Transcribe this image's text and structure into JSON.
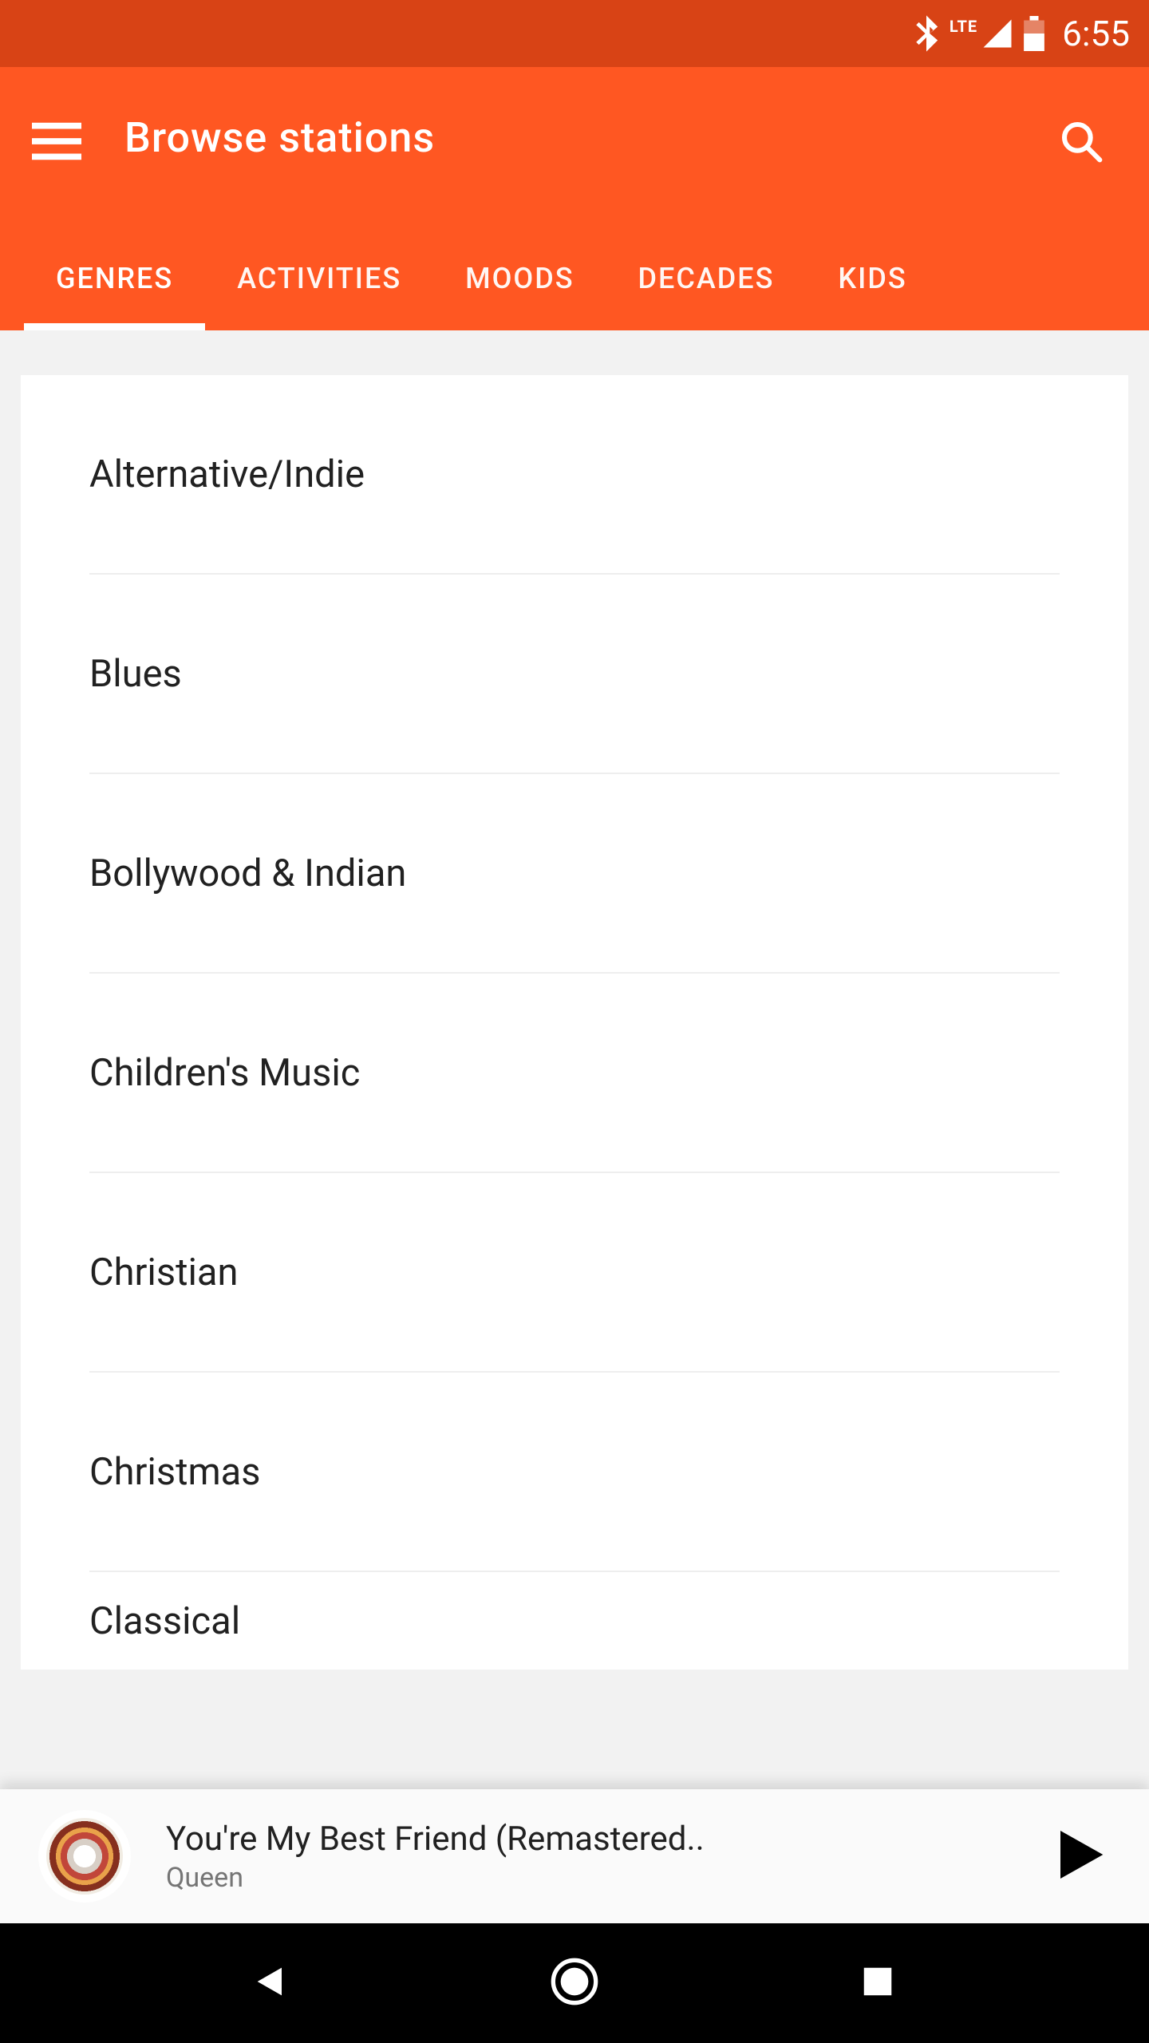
{
  "status_bar": {
    "time": "6:55",
    "network_label": "LTE"
  },
  "header": {
    "title": "Browse stations"
  },
  "tabs": [
    {
      "label": "GENRES",
      "active": true
    },
    {
      "label": "ACTIVITIES",
      "active": false
    },
    {
      "label": "MOODS",
      "active": false
    },
    {
      "label": "DECADES",
      "active": false
    },
    {
      "label": "KIDS",
      "active": false
    }
  ],
  "genres": {
    "items": [
      "Alternative/Indie",
      "Blues",
      "Bollywood & Indian",
      "Children's Music",
      "Christian",
      "Christmas",
      "Classical"
    ]
  },
  "now_playing": {
    "title": "You're My Best Friend (Remastered..",
    "artist": "Queen"
  },
  "colors": {
    "statusbar": "#D84315",
    "appbar": "#FF5722",
    "text_primary": "#212121",
    "text_secondary": "#757575"
  }
}
